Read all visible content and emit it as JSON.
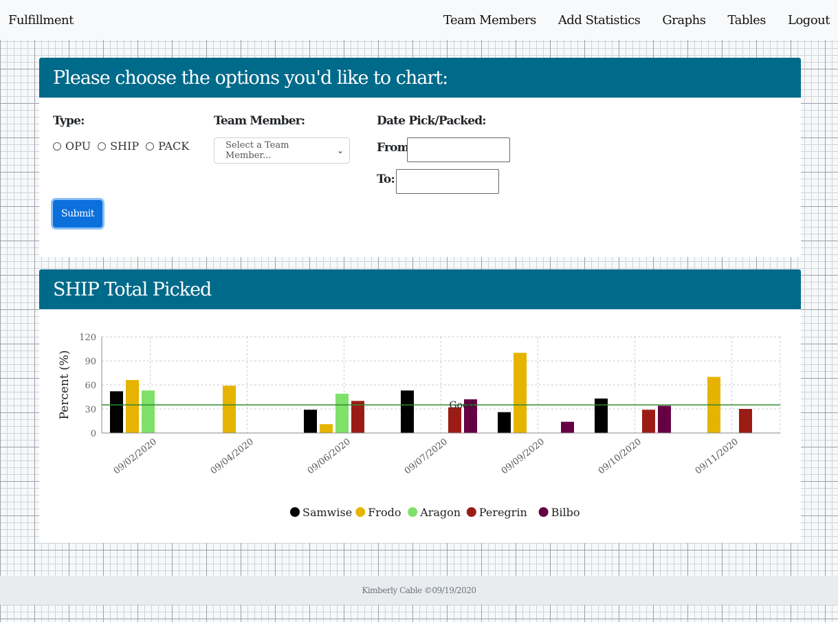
{
  "navbar": {
    "brand": "Fulfillment",
    "links": [
      "Team Members",
      "Add Statistics",
      "Graphs",
      "Tables",
      "Logout"
    ]
  },
  "options_card": {
    "header": "Please choose the options you'd like to chart:",
    "type_label": "Type:",
    "type_options": [
      "OPU",
      "SHIP",
      "PACK"
    ],
    "team_member_label": "Team Member:",
    "team_member_placeholder": "Select a Team Member...",
    "date_label": "Date Pick/Packed:",
    "from_label": "From:",
    "to_label": "To:",
    "from_value": "",
    "to_value": "",
    "submit_label": "Submit"
  },
  "chart_card": {
    "header": "SHIP Total Picked"
  },
  "chart_data": {
    "type": "bar",
    "ylabel": "Percent (%)",
    "ylim": [
      0,
      120
    ],
    "yticks": [
      "0",
      "30",
      "60",
      "90",
      "120"
    ],
    "grid": true,
    "legend_position": "bottom",
    "categories": [
      "09/02/2020",
      "09/04/2020",
      "09/06/2020",
      "09/07/2020",
      "09/09/2020",
      "09/10/2020",
      "09/11/2020"
    ],
    "series": [
      {
        "name": "Samwise",
        "color": "#000000",
        "values": [
          52,
          null,
          29,
          53,
          26,
          43,
          null
        ]
      },
      {
        "name": "Frodo",
        "color": "#e6b400",
        "values": [
          66,
          59,
          11,
          null,
          100,
          null,
          70
        ]
      },
      {
        "name": "Aragon",
        "color": "#7fe06a",
        "values": [
          53,
          null,
          49,
          null,
          null,
          null,
          null
        ]
      },
      {
        "name": "Peregrin",
        "color": "#9b1c14",
        "values": [
          null,
          null,
          40,
          32,
          null,
          29,
          30
        ]
      },
      {
        "name": "Bilbo",
        "color": "#660044",
        "values": [
          null,
          null,
          null,
          42,
          14,
          34,
          null
        ]
      }
    ],
    "reference_line": {
      "value": 35,
      "label": "Good",
      "color": "#2e8b2e"
    }
  },
  "footer": {
    "text": "Kimberly Cable ©09/19/2020"
  }
}
